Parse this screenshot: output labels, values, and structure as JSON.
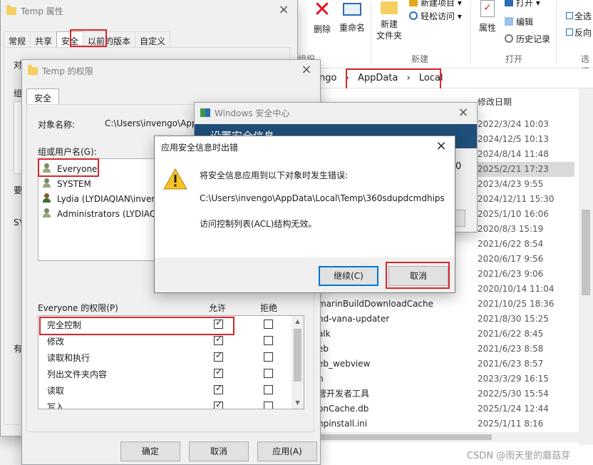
{
  "ribbon": {
    "delete_label": "删除",
    "rename_label": "重命名",
    "new_folder_label": "新建\n文件夹",
    "new_item_label": "新建项目 ▾",
    "easy_access_label": "轻松访问 ▾",
    "group_organize": "组织",
    "group_new": "新建",
    "open_label": "打开 ▾",
    "edit_label": "编辑",
    "history_label": "历史记录",
    "properties_label": "属性",
    "group_open": "打开",
    "select_all_label": "全选",
    "invert_label": "反向",
    "group_select": "选择"
  },
  "address": {
    "partial": "ngo",
    "crumbs": [
      "AppData",
      "Local"
    ],
    "sep": "›"
  },
  "files": {
    "date_header": "修改日期",
    "dates": [
      "2022/3/24 10:03",
      "2024/12/5 10:13",
      "2024/8/14 11:48",
      "2025/2/21 17:23",
      "2023/4/23 9:55",
      "2024/12/11 15:30",
      "2025/1/10 16:06",
      "2020/8/3 15:19",
      "2021/6/22 8:54",
      "2020/6/17 9:56",
      "2021/6/23 9:06",
      "2020/10/14 11:04",
      "2021/10/25 18:36",
      "2021/8/30 15:25",
      "2021/6/22 8:45",
      "2021/6/23 8:58",
      "2021/6/23 8:57",
      "2023/3/29 16:15",
      "2022/5/30 15:54",
      "2025/1/24 12:44",
      "2025/1/11 8:16"
    ],
    "names_partial": [
      "marinBuildDownloadCache",
      "nd-vana-updater",
      "alk",
      "eb",
      "eb_webview",
      "n",
      "营开发者工具",
      "onCache.db",
      "npinstall.ini"
    ]
  },
  "temp_props": {
    "title": "Temp 属性",
    "tabs": [
      "常规",
      "共享",
      "安全",
      "以前的版本",
      "自定义"
    ],
    "active_tab": "安全",
    "side_labels": [
      "对",
      "组或",
      "要",
      "SY",
      "有"
    ]
  },
  "perm": {
    "title": "Temp 的权限",
    "tab": "安全",
    "object_label": "对象名称:",
    "object_value": "C:\\Users\\invengo\\AppData\\Local\\Temp",
    "group_label": "组或用户名(G):",
    "users": [
      "Everyone",
      "SYSTEM",
      "Lydia (LYDIAQIAN\\invengo)",
      "Administrators (LYDIAQIAN\\Administrators)"
    ],
    "perm_header": "Everyone 的权限(P)",
    "allow_header": "允许",
    "deny_header": "拒绝",
    "rows": [
      {
        "name": "完全控制",
        "allow": true,
        "deny": false
      },
      {
        "name": "修改",
        "allow": true,
        "deny": false
      },
      {
        "name": "读取和执行",
        "allow": true,
        "deny": false
      },
      {
        "name": "列出文件夹内容",
        "allow": true,
        "deny": false
      },
      {
        "name": "读取",
        "allow": true,
        "deny": false
      },
      {
        "name": "写入",
        "allow": true,
        "deny": false
      }
    ],
    "ok_label": "确定",
    "cancel_label": "取消",
    "apply_label": "应用(A)"
  },
  "security_center": {
    "title": "Windows 安全中心",
    "banner_text": "设置安全信息",
    "side_text": "0"
  },
  "error_dialog": {
    "title": "应用安全信息时出错",
    "message": "将安全信息应用到以下对象时发生错误:",
    "path": "C:\\Users\\invengo\\AppData\\Local\\Temp\\360sdupdcmdhips",
    "detail": "访问控制列表(ACL)结构无效。",
    "continue_label": "继续(C)",
    "cancel_label": "取消"
  },
  "watermark": "CSDN @雨天里的蘑菇芽",
  "colors": {
    "highlight_red": "#d8262c",
    "accent_blue": "#0078d7",
    "warning_yellow": "#f7c325",
    "delete_red": "#e81123",
    "selected_row": "#d9d9d9"
  }
}
